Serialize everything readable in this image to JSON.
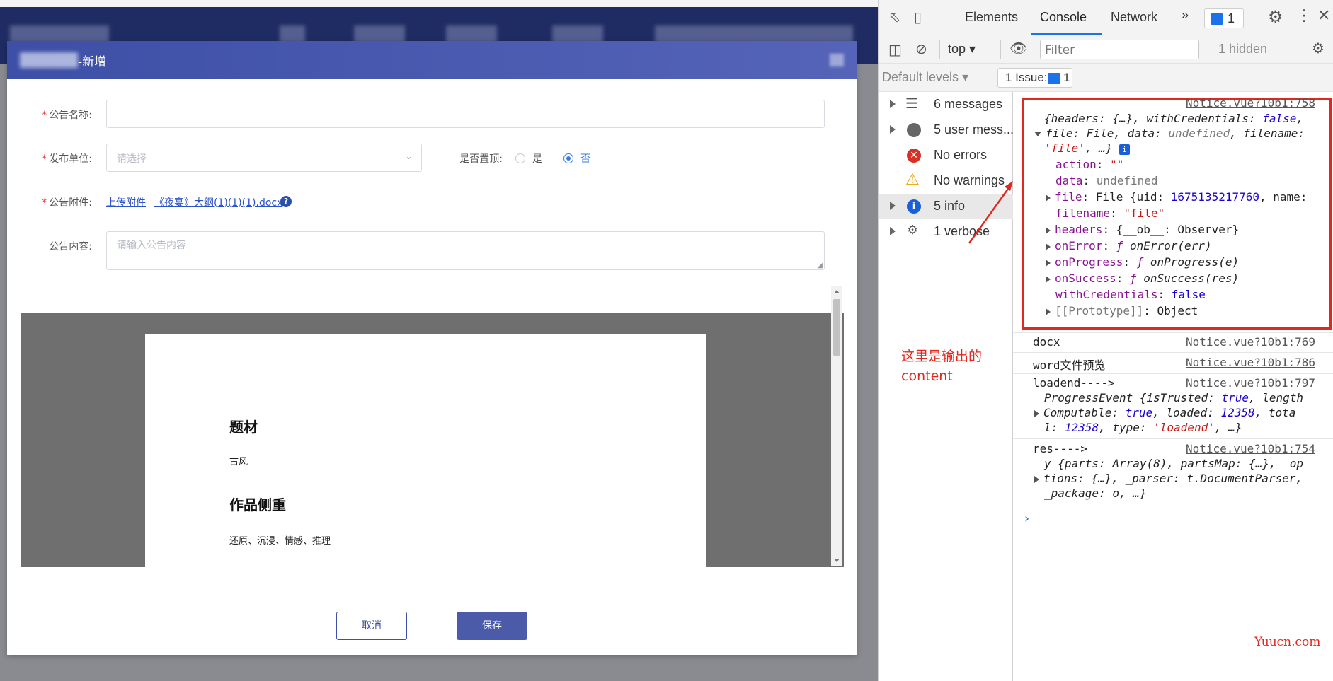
{
  "dialog": {
    "title": "-新增",
    "fields": {
      "name_label": "公告名称:",
      "unit_label": "发布单位:",
      "unit_placeholder": "请选择",
      "top_label": "是否置顶:",
      "top_yes": "是",
      "top_no": "否",
      "top_selected": "否",
      "attach_label": "公告附件:",
      "attach_upload": "上传附件",
      "attach_file": "《夜宴》大纲(1)(1)(1).docx",
      "content_label": "公告内容:",
      "content_placeholder": "请输入公告内容"
    },
    "preview": {
      "heading1": "题材",
      "para1": "古风",
      "heading2": "作品侧重",
      "para2": "还原、沉浸、情感、推理"
    },
    "buttons": {
      "cancel": "取消",
      "save": "保存"
    }
  },
  "devtools": {
    "tabs": [
      "Elements",
      "Console",
      "Network"
    ],
    "active_tab": "Console",
    "more_tabs": "»",
    "message_badge_count": "1",
    "toolbar": {
      "context": "top",
      "filter_placeholder": "Filter",
      "hidden": "1 hidden",
      "default_levels": "Default levels",
      "issues": "1 Issue:",
      "issues_count": "1"
    },
    "sidebar": [
      {
        "label": "6 messages",
        "icon": "list-icon"
      },
      {
        "label": "5 user mess...",
        "icon": "user-icon"
      },
      {
        "label": "No errors",
        "icon": "error-icon"
      },
      {
        "label": "No warnings",
        "icon": "warning-icon"
      },
      {
        "label": "5 info",
        "icon": "info-icon",
        "selected": true
      },
      {
        "label": "1 verbose",
        "icon": "bug-icon"
      }
    ],
    "annotation_line1": "这里是输出的",
    "annotation_line2": "content",
    "log": {
      "entry1_src": "Notice.vue?10b1:758",
      "entry2_text": "docx",
      "entry2_src": "Notice.vue?10b1:769",
      "entry3_text": "word文件预览",
      "entry3_src": "Notice.vue?10b1:786",
      "entry4_text": "loadend---->",
      "entry4_src": "Notice.vue?10b1:797",
      "entry5_text": "res---->",
      "entry5_src": "Notice.vue?10b1:754",
      "prompt": "›"
    }
  },
  "watermark": "Yuucn.com",
  "colors": {
    "navbar": "#1f2b63",
    "dialog_header": "#3d4fa6",
    "save_button": "#4b5aa9",
    "devtools_accent": "#1a73e8",
    "annotation": "#e0281e"
  }
}
